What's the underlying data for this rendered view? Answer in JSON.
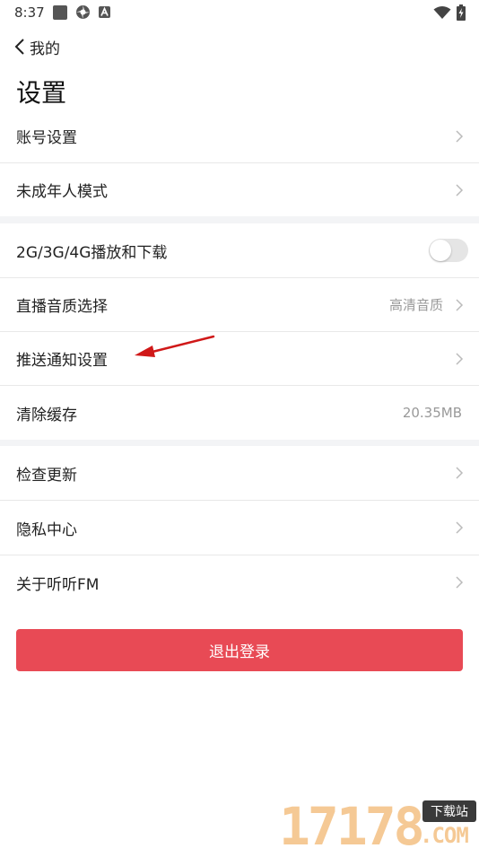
{
  "status_bar": {
    "time": "8:37"
  },
  "nav": {
    "back_label": "我的"
  },
  "page": {
    "title": "设置"
  },
  "sections": {
    "account": [
      {
        "label": "账号设置"
      },
      {
        "label": "未成年人模式"
      }
    ],
    "playback": [
      {
        "label": "2G/3G/4G播放和下载",
        "toggle_on": false
      },
      {
        "label": "直播音质选择",
        "value": "高清音质"
      },
      {
        "label": "推送通知设置"
      },
      {
        "label": "清除缓存",
        "value": "20.35MB"
      }
    ],
    "about": [
      {
        "label": "检查更新"
      },
      {
        "label": "隐私中心"
      },
      {
        "label": "关于听听FM"
      }
    ]
  },
  "logout": {
    "label": "退出登录"
  },
  "watermark": {
    "digits": "17178",
    "tag": "下载站",
    "domain": ".COM"
  },
  "colors": {
    "accent": "#e84a55",
    "annotation_arrow": "#d01818",
    "section_gap": "#f3f4f6"
  }
}
